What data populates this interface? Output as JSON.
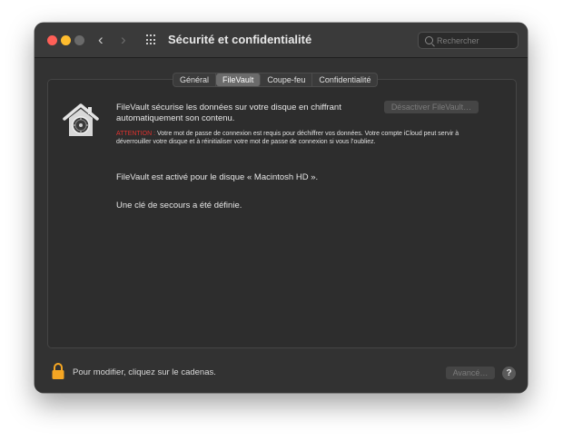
{
  "window": {
    "title": "Sécurité et confidentialité",
    "search_placeholder": "Rechercher"
  },
  "tabs": [
    {
      "label": "Général",
      "active": false
    },
    {
      "label": "FileVault",
      "active": true
    },
    {
      "label": "Coupe-feu",
      "active": false
    },
    {
      "label": "Confidentialité",
      "active": false
    }
  ],
  "filevault": {
    "description": "FileVault sécurise les données sur votre disque en chiffrant automatiquement son contenu.",
    "disable_button": "Désactiver FileVault…",
    "warning_label": "ATTENTION :",
    "warning_text": "Votre mot de passe de connexion est requis pour déchiffrer vos données. Votre compte iCloud peut servir à déverrouiller votre disque et à réinitialiser votre mot de passe de connexion si vous l’oubliez.",
    "status_enabled": "FileVault est activé pour le disque « Macintosh HD ».",
    "status_recovery": "Une clé de secours a été définie."
  },
  "footer": {
    "lock_text": "Pour modifier, cliquez sur le cadenas.",
    "advanced_button": "Avancé…",
    "help_label": "?"
  },
  "icons": {
    "filevault": "filevault-house-icon",
    "lock": "lock-icon",
    "search": "search-icon",
    "grid": "grid-icon"
  },
  "colors": {
    "warning": "#e0322f",
    "lock": "#f5a623",
    "close": "#fe5f57",
    "minimize": "#febc2e"
  }
}
